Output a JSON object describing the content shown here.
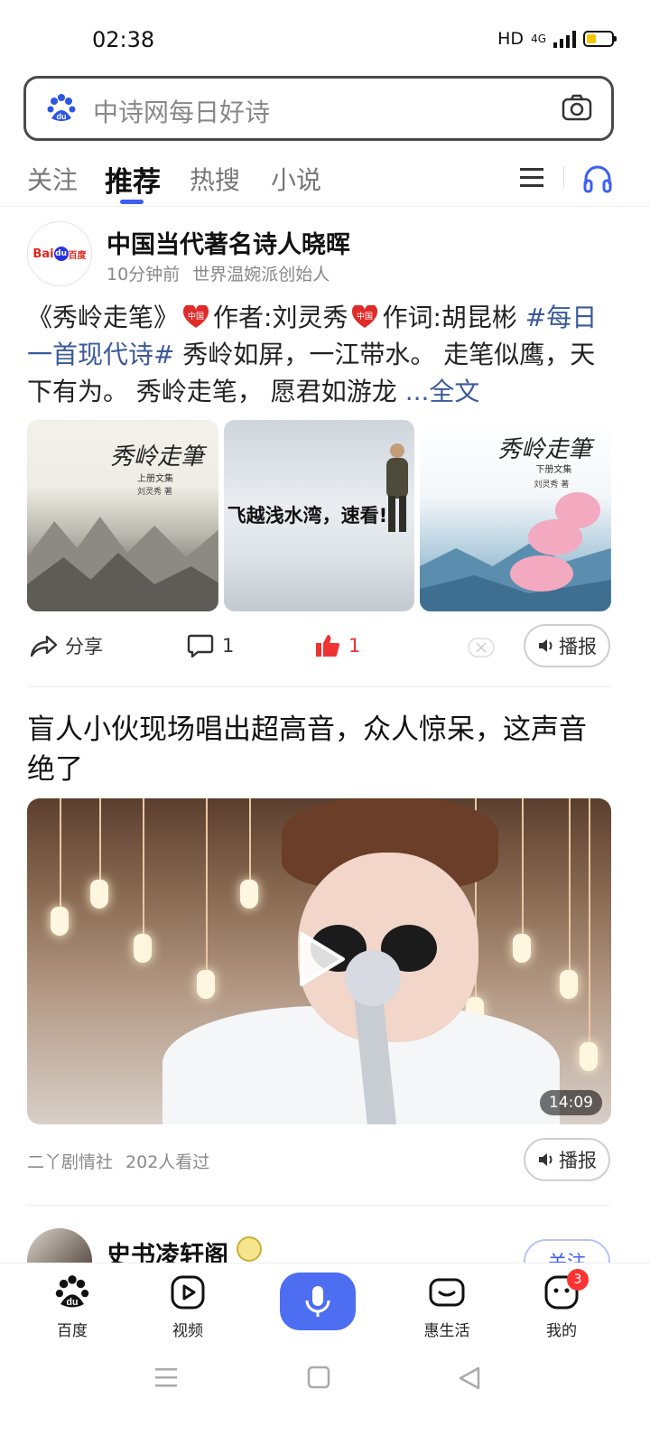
{
  "status_bar": {
    "time": "02:38",
    "hd": "HD",
    "network": "4G"
  },
  "search": {
    "placeholder": "中诗网每日好诗"
  },
  "tabs": [
    {
      "label": "关注"
    },
    {
      "label": "推荐",
      "active": true
    },
    {
      "label": "热搜"
    },
    {
      "label": "小说"
    }
  ],
  "post1": {
    "author": "中国当代著名诗人晓晖",
    "time": "10分钟前",
    "subtitle": "世界温婉派创始人",
    "avatar_text": {
      "bai": "Bai",
      "du": "du",
      "tail": "百度"
    },
    "text": {
      "part1": "《秀岭走笔》",
      "part2": "作者:刘灵秀",
      "part3": "作词:胡昆彬",
      "hashtag": "#每日一首现代诗#",
      "part4": "秀岭如屏，一江带水。 走笔似鹰，天下有为。 秀岭走笔， 愿君如游龙",
      "more": "...全文"
    },
    "images": [
      {
        "title": "秀岭走筆",
        "subtitle": "上册文集",
        "author": "刘灵秀 著"
      },
      {
        "overlay": "飞越浅水湾，速看!"
      },
      {
        "title": "秀岭走筆",
        "subtitle": "下册文集",
        "author": "刘灵秀 著"
      }
    ],
    "actions": {
      "share": "分享",
      "comments": "1",
      "likes": "1",
      "broadcast": "播报"
    }
  },
  "post2": {
    "title": "盲人小伙现场唱出超高音，众人惊呆，这声音绝了",
    "duration": "14:09",
    "source": "二丫剧情社",
    "views": "202人看过",
    "broadcast": "播报"
  },
  "post3": {
    "author": "史书凌轩阁",
    "follow": "关注"
  },
  "bottom_nav": [
    {
      "label": "百度",
      "icon": "baidu-paw-icon"
    },
    {
      "label": "视频",
      "icon": "video-play-icon"
    },
    {
      "label": "",
      "icon": "microphone-icon"
    },
    {
      "label": "惠生活",
      "icon": "wallet-icon"
    },
    {
      "label": "我的",
      "icon": "profile-face-icon",
      "badge": "3"
    }
  ],
  "colors": {
    "accent": "#4e6ef2",
    "link": "#3c5a9a",
    "like": "#e33333",
    "badge": "#ff3333"
  }
}
